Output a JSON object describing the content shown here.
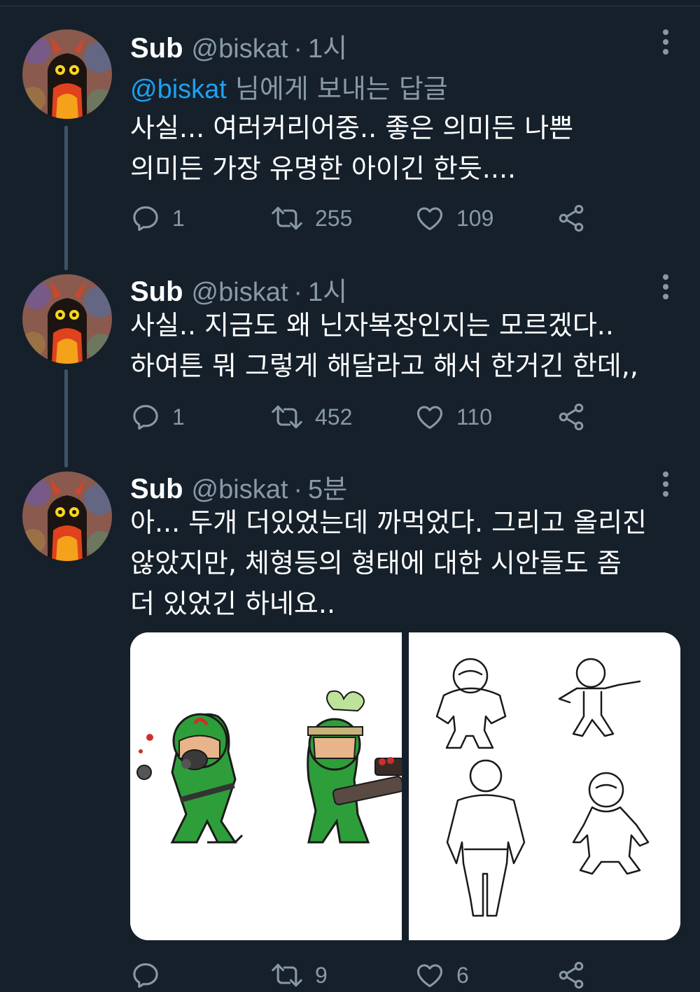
{
  "tweets": [
    {
      "name": "Sub",
      "handle": "@biskat",
      "dot": "·",
      "time": "1시",
      "reply_to": {
        "mention": "@biskat",
        "suffix": " 님에게 보내는 답글"
      },
      "lines": [
        "사실... 여러커리어중.. 좋은 의미든 나쁜",
        "의미든 가장 유명한 아이긴 한듯...."
      ],
      "replies": "1",
      "retweets": "255",
      "likes": "109"
    },
    {
      "name": "Sub",
      "handle": "@biskat",
      "dot": "·",
      "time": "1시",
      "lines": [
        "사실.. 지금도 왜 닌자복장인지는 모르겠다..",
        "하여튼 뭐 그렇게 해달라고 해서 한거긴 한데,,"
      ],
      "replies": "1",
      "retweets": "452",
      "likes": "110"
    },
    {
      "name": "Sub",
      "handle": "@biskat",
      "dot": "·",
      "time": "5분",
      "lines": [
        "아... 두개 더있었는데 까먹었다. 그리고 올리진",
        "않았지만, 체형등의 형태에 대한 시안들도 좀",
        "더 있었긴 하네요.."
      ],
      "replies": "",
      "retweets": "9",
      "likes": "6"
    }
  ],
  "icons": {
    "reply": "reply-bubble-icon",
    "retweet": "retweet-icon",
    "like": "heart-icon",
    "share": "share-icon",
    "more": "more-dots-icon"
  },
  "colors": {
    "background": "#15202b",
    "muted": "#8899a6",
    "link": "#1da1f2",
    "thread": "#3d5466"
  }
}
